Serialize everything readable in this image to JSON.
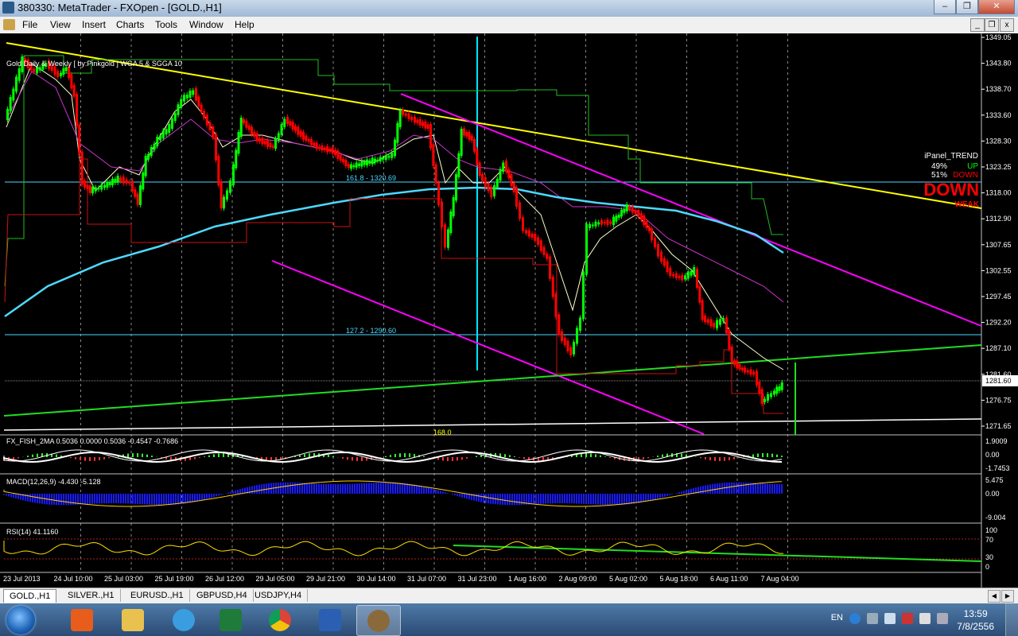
{
  "window": {
    "title": "380330: MetaTrader - FXOpen - [GOLD.,H1]"
  },
  "menu": [
    "File",
    "View",
    "Insert",
    "Charts",
    "Tools",
    "Window",
    "Help"
  ],
  "chart": {
    "symbol": "GOLD.,H1",
    "indicator_label": "Gold Daily & Weekly [ by:Pinkgold ] WGA 5 & SGGA 10",
    "price_axis": [
      "1349.05",
      "1343.80",
      "1338.70",
      "1333.60",
      "1328.30",
      "1323.25",
      "1318.00",
      "1312.90",
      "1307.65",
      "1302.55",
      "1297.45",
      "1292.20",
      "1287.10",
      "1281.60",
      "1276.75",
      "1271.65"
    ],
    "current_price": "1281.60",
    "time_axis": [
      "23 Jul 2013",
      "24 Jul 10:00",
      "25 Jul 03:00",
      "25 Jul 19:00",
      "26 Jul 12:00",
      "29 Jul 05:00",
      "29 Jul 21:00",
      "30 Jul 14:00",
      "31 Jul 07:00",
      "31 Jul 23:00",
      "1 Aug 16:00",
      "2 Aug 09:00",
      "5 Aug 02:00",
      "5 Aug 18:00",
      "6 Aug 11:00",
      "7 Aug 04:00"
    ],
    "fib_labels": [
      "161.8 - 1320.69",
      "127.2 - 1290.60",
      "168.0"
    ],
    "ipanel": {
      "title": "iPanel_TREND",
      "up_pct": "49%",
      "up_label": "UP",
      "down_pct": "51%",
      "down_label": "DOWN",
      "signal": "DOWN",
      "strength": "WEAK"
    },
    "fish": {
      "label": "FX_FISH_2MA 0.5036 0.0000 0.5036 -0.4547 -0.7686",
      "axis": [
        "1.9009",
        "0.00",
        "-1.7453"
      ]
    },
    "macd": {
      "label": "MACD(12,26,9) -4.430 -5.128",
      "axis": [
        "5.475",
        "0.00",
        "-9.004"
      ]
    },
    "rsi": {
      "label": "RSI(14) 41.1160",
      "axis": [
        "100",
        "70",
        "30",
        "0"
      ]
    },
    "colors": {
      "bull": "#00ff00",
      "bear": "#ff0000",
      "trend": "#ffff00",
      "channel": "#ff00ff",
      "ma": "#4dd9ff",
      "support": "#22dd22"
    }
  },
  "tabs": [
    "GOLD.,H1",
    "SILVER.,H1",
    "EURUSD.,H1",
    "GBPUSD,H4",
    "USDJPY,H4"
  ],
  "taskbar": {
    "lang": "EN",
    "time": "13:59",
    "date": "7/8/2556",
    "apps": [
      "media-player-icon",
      "file-explorer-icon",
      "internet-explorer-icon",
      "excel-icon",
      "chrome-icon",
      "word-icon",
      "metatrader-icon"
    ]
  }
}
